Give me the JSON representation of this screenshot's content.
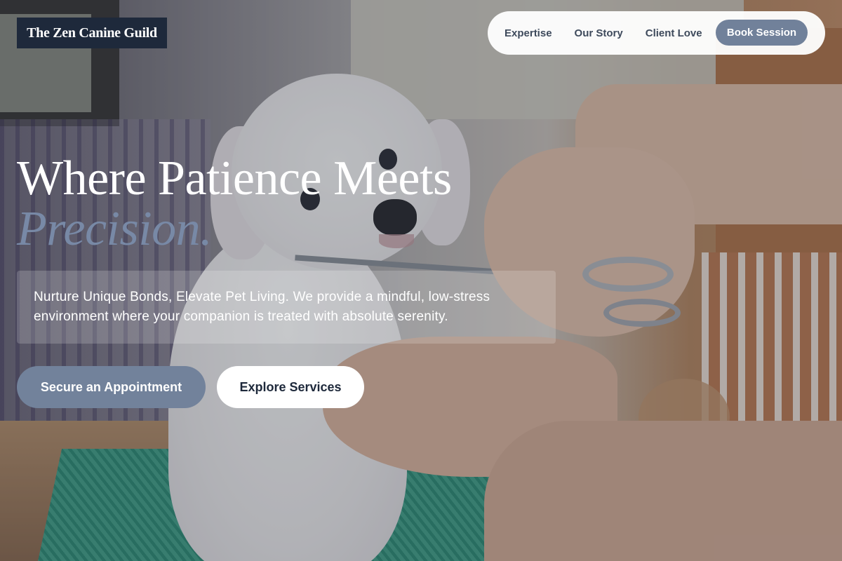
{
  "brand": {
    "name": "The Zen Canine Guild"
  },
  "nav": {
    "links": [
      "Expertise",
      "Our Story",
      "Client Love"
    ],
    "cta_label": "Book Session"
  },
  "hero": {
    "headline": "Where Patience Meets",
    "headline_accent": "Precision.",
    "subtext": "Nurture Unique Bonds, Elevate Pet Living. We provide a mindful, low-stress environment where your companion is treated with absolute serenity.",
    "primary_cta": "Secure an Appointment",
    "secondary_cta": "Explore Services"
  },
  "colors": {
    "brand_bg": "#1e293b",
    "accent": "#72829b",
    "accent_text": "#7889a6"
  }
}
